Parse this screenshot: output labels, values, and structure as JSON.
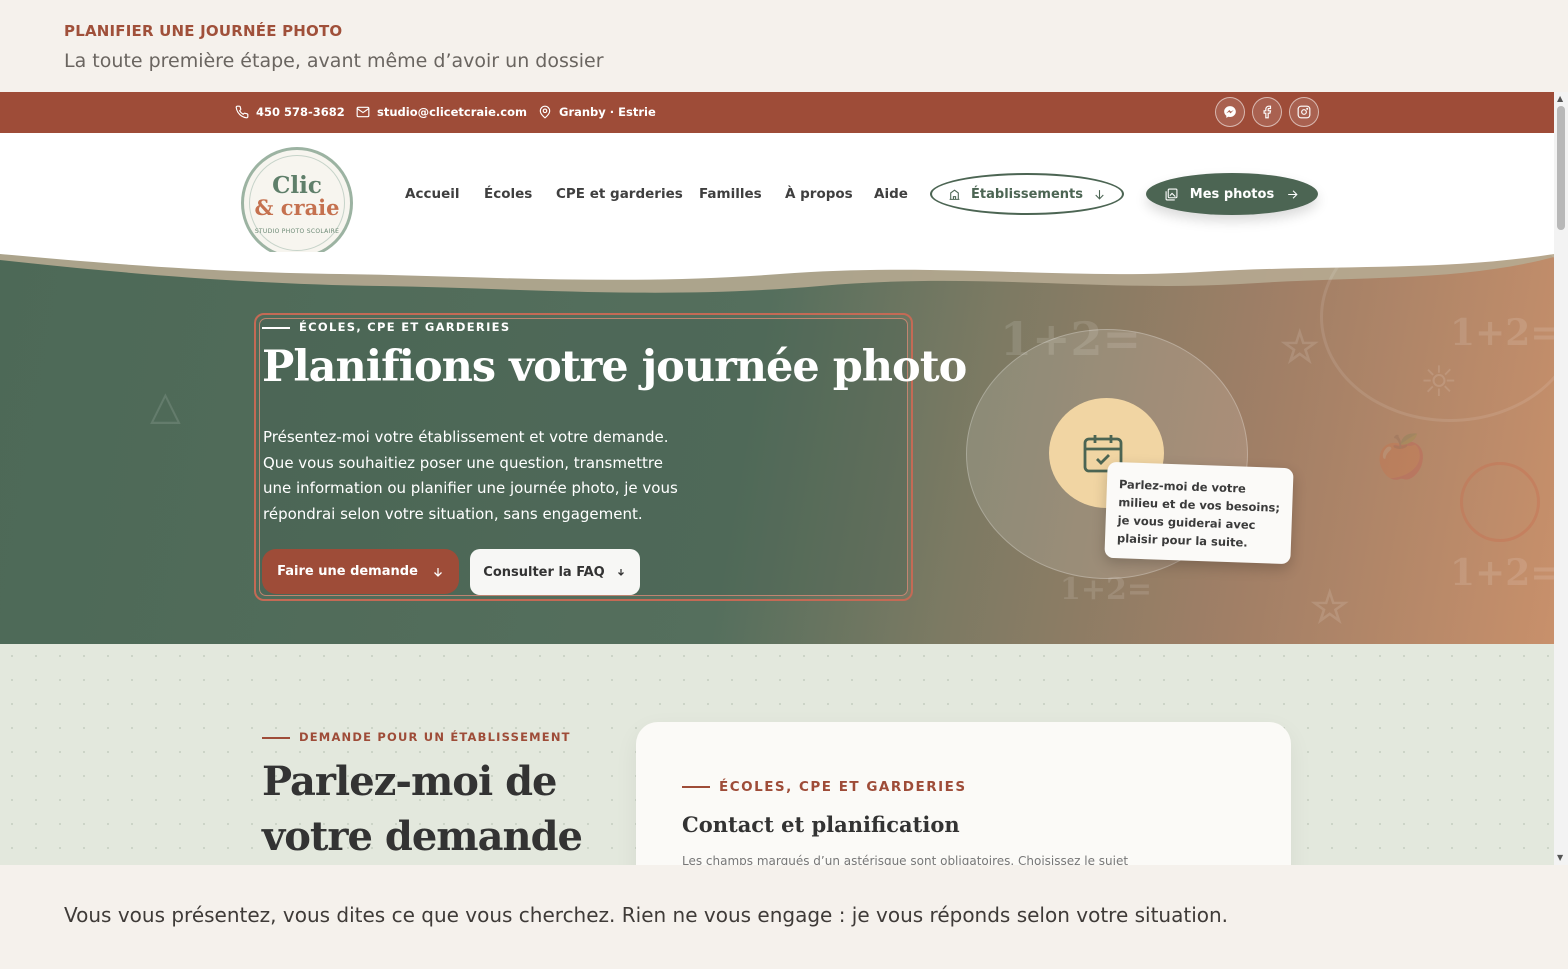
{
  "caption": {
    "eyebrow": "PLANIFIER UNE JOURNÉE PHOTO",
    "subtitle": "La toute première étape, avant même d’avoir un dossier",
    "footer": "Vous vous présentez, vous dites ce que vous cherchez. Rien ne vous engage : je vous réponds selon votre situation."
  },
  "topbar": {
    "phone": "450 578-3682",
    "email": "studio@clicetcraie.com",
    "location": "Granby · Estrie",
    "socials": [
      "messenger-icon",
      "facebook-icon",
      "instagram-icon"
    ]
  },
  "nav": {
    "logo": {
      "line1": "Clic",
      "line2": "& craie",
      "line3": "STUDIO PHOTO SCOLAIRE"
    },
    "links": [
      "Accueil",
      "Écoles",
      "CPE et garderies",
      "Familles",
      "À propos",
      "Aide"
    ],
    "etablissements": "Établissements",
    "mes_photos": "Mes photos"
  },
  "hero": {
    "eyebrow": "ÉCOLES, CPE ET GARDERIES",
    "title": "Planifions votre journée photo",
    "text": [
      "Présentez-moi votre établissement et votre demande.",
      "Que vous souhaitiez poser une question, transmettre",
      "une information ou planifier une journée photo, je vous",
      "répondrai selon votre situation, sans engagement."
    ],
    "primary_button": "Faire une demande",
    "secondary_button": "Consulter la FAQ",
    "note": "Parlez-moi de votre milieu et de vos besoins; je vous guiderai avec plaisir pour la suite."
  },
  "section": {
    "eyebrow": "DEMANDE POUR UN ÉTABLISSEMENT",
    "title": "Parlez-moi de votre demande",
    "form": {
      "eyebrow": "ÉCOLES, CPE ET GARDERIES",
      "title": "Contact et planification",
      "hint": "Les champs marqués d’un astérisque sont obligatoires. Choisissez le sujet"
    }
  },
  "colors": {
    "brand_rust": "#9e4c38",
    "brand_green": "#4c6553",
    "section_bg": "#e3e8dd",
    "caption_bg": "#f5f1ec"
  }
}
